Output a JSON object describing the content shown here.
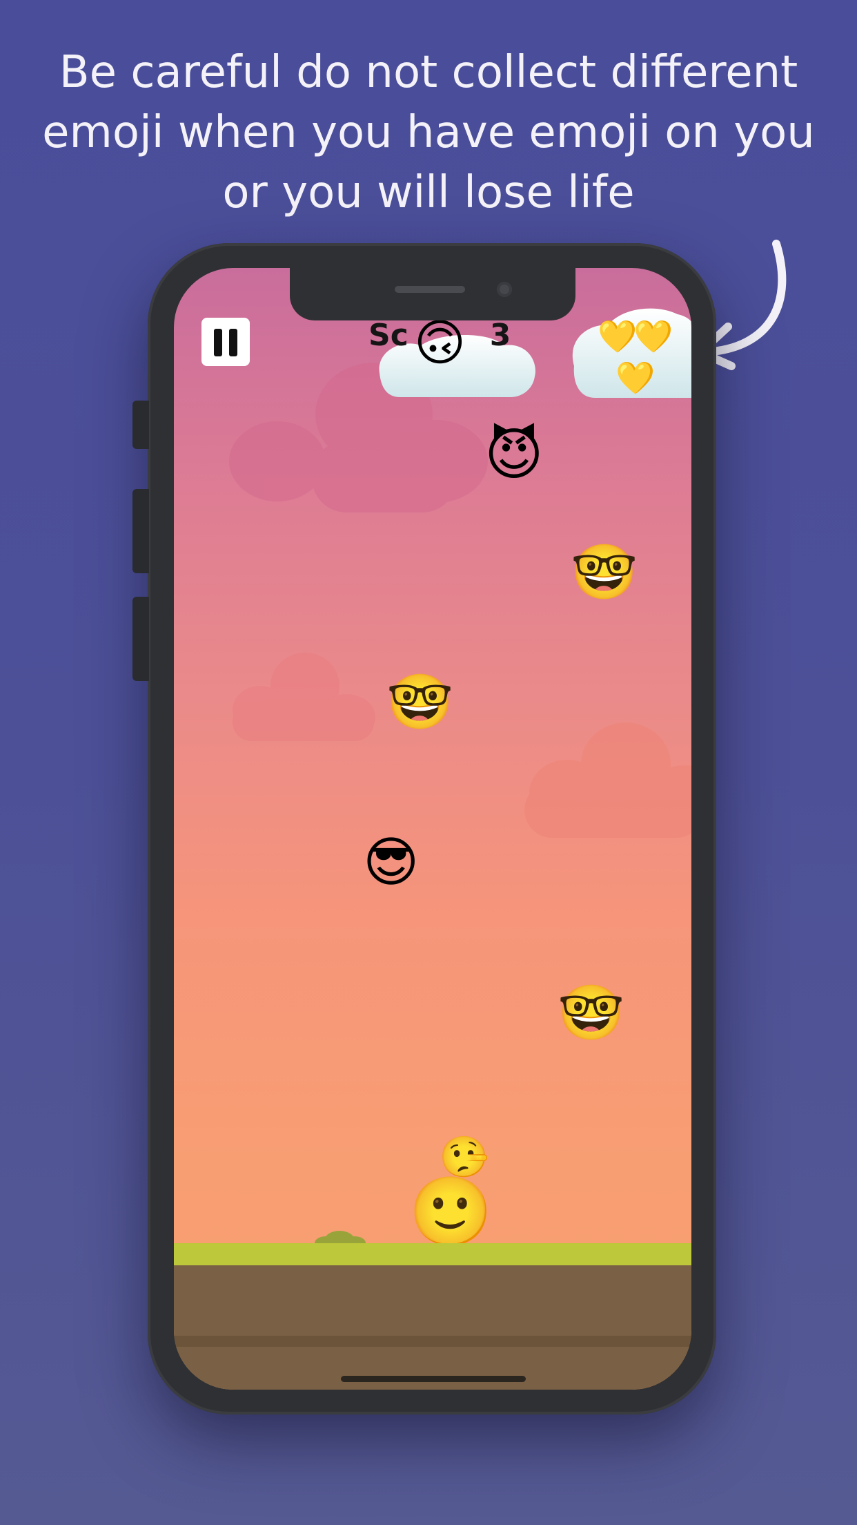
{
  "caption": {
    "line1": "Be careful do not collect different",
    "line2": "emoji when you have emoji on you",
    "line3": "or you will lose life"
  },
  "hud": {
    "score_label": "Score: 3",
    "score_visible": "Sc",
    "score_value": "3",
    "lives_icon": "yellow-heart",
    "lives_count": 3
  },
  "emojis": {
    "score_overlay": "🙃",
    "devil": "😈",
    "nerd_top": "🤓",
    "nerd_mid": "🤓",
    "cool": "😎",
    "nerd_low": "🤓",
    "lying": "🤥",
    "player": "🙂",
    "heart": "💛"
  },
  "colors": {
    "background": "#4a4e9a",
    "sky_top": "#c96d9c",
    "sky_bottom": "#f7a070",
    "grass": "#bdc83a",
    "dirt": "#7a6145"
  }
}
